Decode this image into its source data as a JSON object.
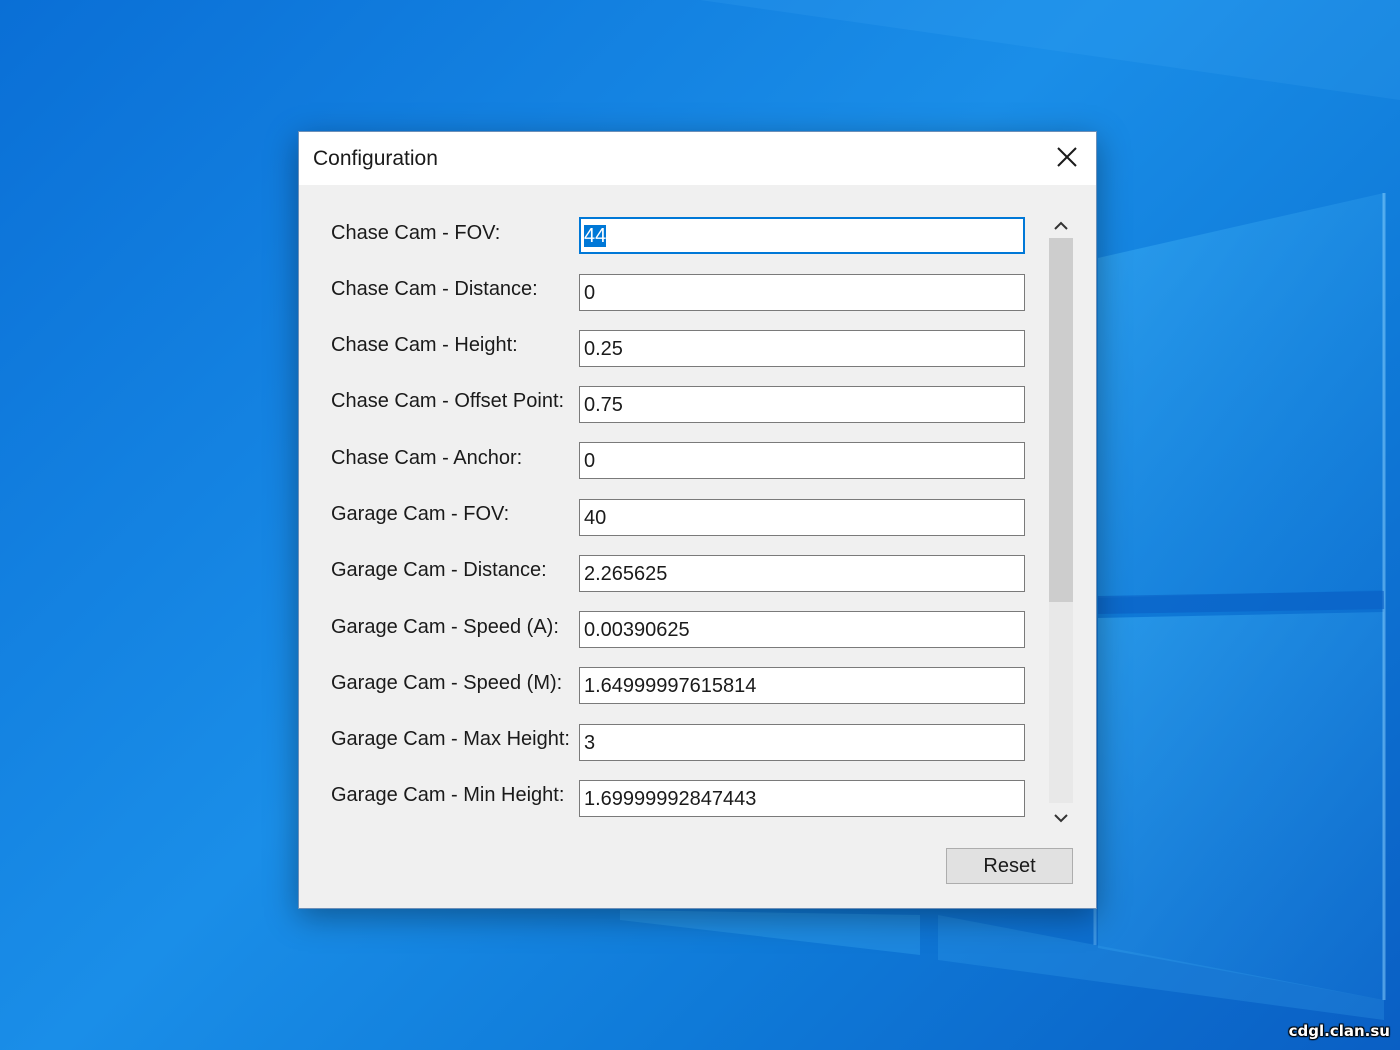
{
  "desktop": {
    "watermark": "cdgl.clan.su"
  },
  "dialog": {
    "title": "Configuration",
    "close_icon": "close-icon",
    "fields": [
      {
        "label": "Chase Cam - FOV:",
        "value": "44",
        "focused": true
      },
      {
        "label": "Chase Cam - Distance:",
        "value": "0"
      },
      {
        "label": "Chase Cam - Height:",
        "value": "0.25"
      },
      {
        "label": "Chase Cam - Offset Point:",
        "value": "0.75"
      },
      {
        "label": "Chase Cam - Anchor:",
        "value": "0"
      },
      {
        "label": "Garage Cam - FOV:",
        "value": "40"
      },
      {
        "label": "Garage Cam - Distance:",
        "value": "2.265625"
      },
      {
        "label": "Garage Cam - Speed (A):",
        "value": "0.00390625"
      },
      {
        "label": "Garage Cam - Speed (M):",
        "value": "1.64999997615814"
      },
      {
        "label": "Garage Cam - Max Height:",
        "value": "3"
      },
      {
        "label": "Garage Cam - Min Height:",
        "value": "1.69999992847443"
      }
    ],
    "scrollbar": {
      "up_icon": "chevron-up-icon",
      "down_icon": "chevron-down-icon"
    },
    "reset_label": "Reset"
  },
  "colors": {
    "desktop_blue": "#0a6fd6",
    "focus_blue": "#0078d7",
    "dialog_bg": "#f0f0f0"
  }
}
